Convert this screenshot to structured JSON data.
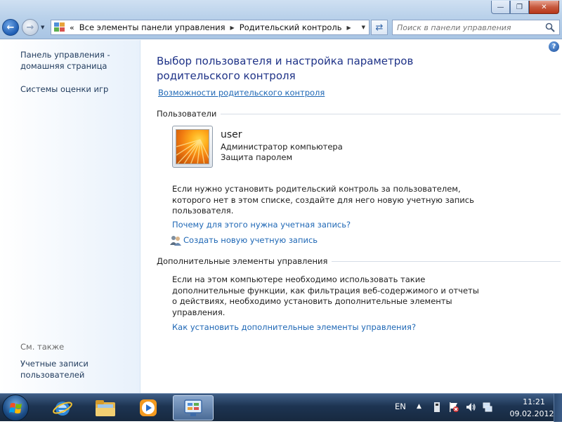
{
  "window": {
    "breadcrumb": [
      "Все элементы панели управления",
      "Родительский контроль"
    ],
    "overflow_chevron": "«",
    "search_placeholder": "Поиск в панели управления",
    "caption": {
      "minimize": "—",
      "maximize": "❐",
      "close": "✕"
    }
  },
  "sidebar": {
    "items": [
      {
        "label_line1": "Панель управления -",
        "label_line2": "домашняя страница"
      },
      {
        "label_line1": "Системы оценки игр",
        "label_line2": ""
      }
    ],
    "see_also_label": "См. также",
    "see_also_items": [
      {
        "label_line1": "Учетные записи",
        "label_line2": "пользователей"
      }
    ]
  },
  "main": {
    "title_line1": "Выбор пользователя и настройка параметров",
    "title_line2": "родительского контроля",
    "features_link": "Возможности родительского контроля",
    "users_section": "Пользователи",
    "user": {
      "name": "user",
      "role": "Администратор компьютера",
      "password": "Защита паролем"
    },
    "info_lines": [
      "Если нужно установить родительский контроль за пользователем,",
      "которого нет в этом списке, создайте для него новую учетную запись",
      "пользователя."
    ],
    "why_link": "Почему для этого нужна учетная запись?",
    "create_link": "Создать новую учетную запись",
    "extra_section": "Дополнительные элементы управления",
    "extra_lines": [
      "Если на этом компьютере необходимо использовать такие",
      "дополнительные функции, как фильтрация веб-содержимого и отчеты",
      "о действиях, необходимо установить дополнительные элементы",
      "управления."
    ],
    "install_link": "Как установить дополнительные элементы управления?"
  },
  "taskbar": {
    "apps": [
      "internet-explorer-icon",
      "explorer-folder-icon",
      "media-player-icon",
      "control-panel-icon"
    ],
    "active_app": "control-panel-icon",
    "language": "EN",
    "time": "11:21",
    "date": "09.02.2012"
  },
  "colors": {
    "title_blue": "#1e3287",
    "link_blue": "#1e67b5",
    "taskbar": "#1d3452"
  }
}
